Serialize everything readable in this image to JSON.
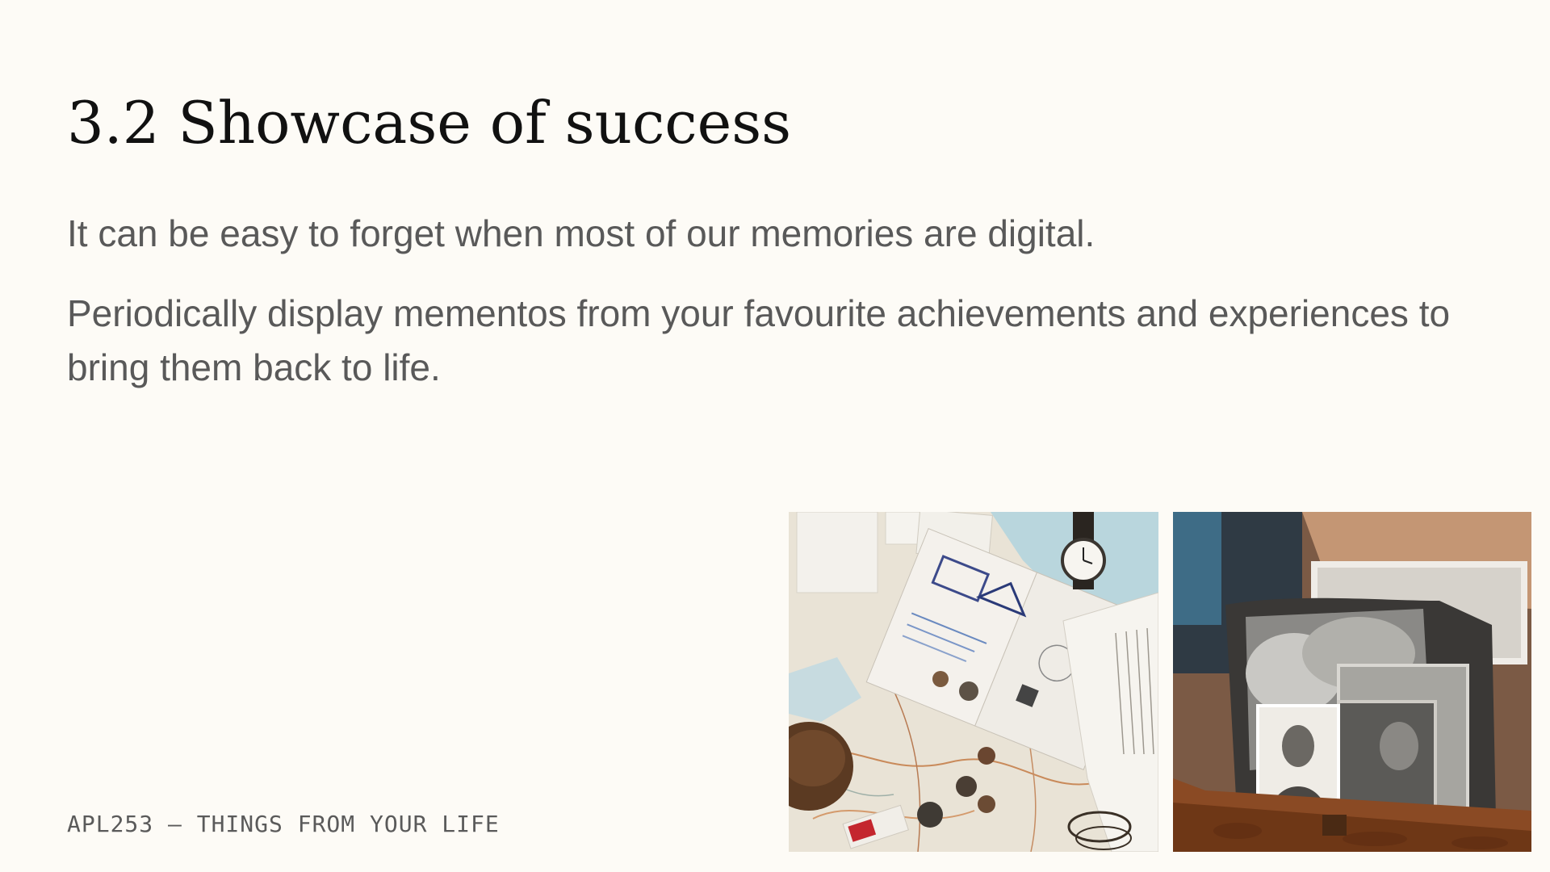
{
  "slide": {
    "title": "3.2 Showcase of success",
    "paragraphs": [
      "It can be easy to forget when most of our memories are digital.",
      "Periodically display mementos from your favourite achievements and experiences to bring them back to life."
    ],
    "footer": "APL253 – THINGS FROM YOUR LIFE"
  },
  "photos": [
    {
      "name": "travel-mementos",
      "subject": "passport, map, coins, watch and book flat-lay"
    },
    {
      "name": "old-photos-box",
      "subject": "vintage black-and-white photos in a wooden box"
    }
  ],
  "colors": {
    "background": "#fdfbf6",
    "title": "#111111",
    "body": "#595959",
    "footer": "#5a5a5a"
  }
}
